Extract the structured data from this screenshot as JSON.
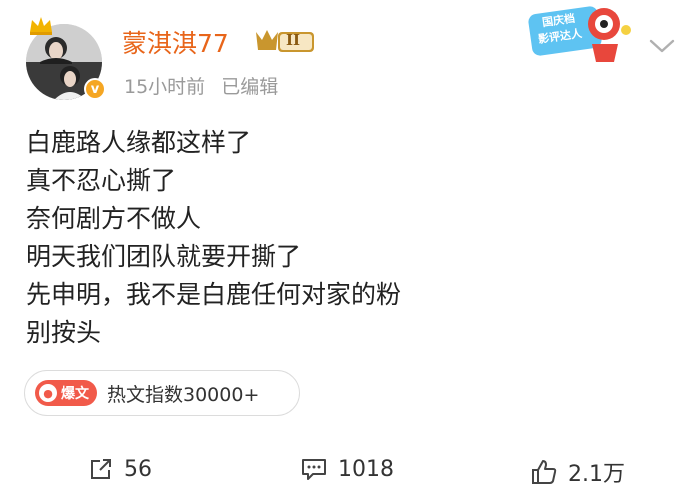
{
  "header": {
    "username": "蒙淇淇77",
    "timestamp": "15小时前",
    "edited_label": "已编辑",
    "level_badge": "II",
    "promo_line1": "国庆档",
    "promo_line2": "影评达人"
  },
  "post": {
    "lines": [
      "白鹿路人缘都这样了",
      "真不忍心撕了",
      "奈何剧方不做人",
      "明天我们团队就要开撕了",
      "先申明，我不是白鹿任何对家的粉",
      "别按头"
    ]
  },
  "hot": {
    "tag": "爆文",
    "text": "热文指数30000+"
  },
  "actions": {
    "repost_count": "56",
    "comment_count": "1018",
    "like_count": "2.1万"
  },
  "colors": {
    "username": "#e8651a",
    "hot_tag": "#f15a4a",
    "verified_badge": "#f5a623",
    "meta_text": "#9a9a9a"
  },
  "icons": [
    "crown-icon",
    "verified-badge-icon",
    "level-badge-icon",
    "chevron-down-icon",
    "flame-icon",
    "repost-icon",
    "comment-icon",
    "like-icon"
  ]
}
